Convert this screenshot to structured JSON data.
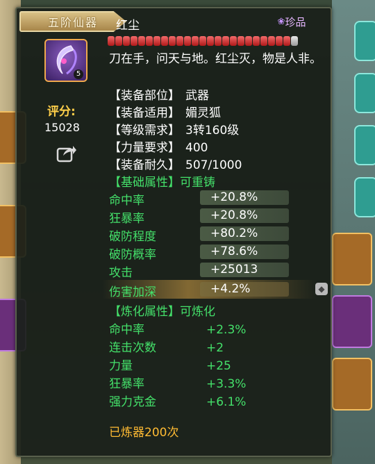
{
  "item": {
    "tier": "五阶仙器",
    "name": "红尘",
    "rarity": "珍品",
    "durability_pips_filled": 24,
    "durability_pips_total": 25,
    "icon_level": "5",
    "score_label": "评分:",
    "score": "15028",
    "description": "刀在手，问天与地。红尘灭，物是人非。"
  },
  "info_rows": [
    {
      "key": "【装备部位】",
      "value": "武器"
    },
    {
      "key": "【装备适用】",
      "value": "媚灵狐"
    },
    {
      "key": "【等级需求】",
      "value": "3转160级"
    },
    {
      "key": "【力量要求】",
      "value": "400"
    },
    {
      "key": "【装备耐久】",
      "value": "507/1000"
    }
  ],
  "base_section": "【基础属性】可重铸",
  "base_attrs": [
    {
      "key": "命中率",
      "value": "+20.8%"
    },
    {
      "key": "狂暴率",
      "value": "+20.8%"
    },
    {
      "key": "破防程度",
      "value": "+80.2%"
    },
    {
      "key": "破防概率",
      "value": "+78.6%"
    },
    {
      "key": "攻击",
      "value": "+25013"
    },
    {
      "key": "伤害加深",
      "value": "+4.2%"
    }
  ],
  "refine_section": "【炼化属性】可炼化",
  "refine_attrs": [
    {
      "key": "命中率",
      "value": "+2.3%"
    },
    {
      "key": "连击次数",
      "value": "+2"
    },
    {
      "key": "力量",
      "value": "+25"
    },
    {
      "key": "狂暴率",
      "value": "+3.3%"
    },
    {
      "key": "强力克金",
      "value": "+6.1%"
    }
  ],
  "refined_text": "已炼器200次",
  "colors": {
    "attr_green": "#44e06a",
    "score_gold": "#ffcf4a",
    "refined_orange": "#ffbb33",
    "durability_red": "#d62828"
  }
}
